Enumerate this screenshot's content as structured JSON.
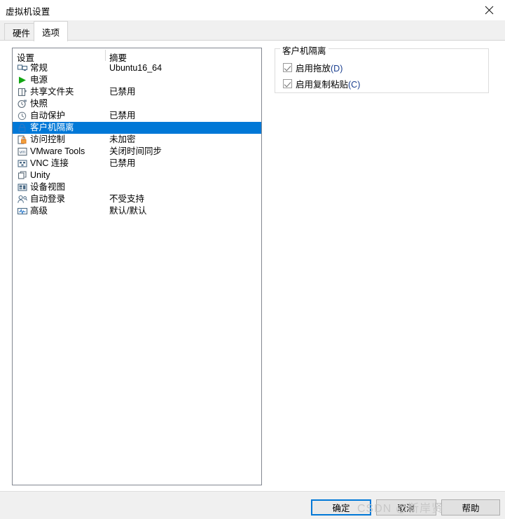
{
  "window": {
    "title": "虚拟机设置",
    "close_icon": "close-icon"
  },
  "tabs": [
    {
      "id": "hardware",
      "label": "硬件",
      "active": false
    },
    {
      "id": "options",
      "label": "选项",
      "active": true
    }
  ],
  "settings_list": {
    "columns": {
      "setting": "设置",
      "summary": "摘要"
    },
    "rows": [
      {
        "icon": "monitor-icon",
        "label": "常规",
        "summary": "Ubuntu16_64",
        "selected": false
      },
      {
        "icon": "power-play-icon",
        "label": "电源",
        "summary": "",
        "selected": false
      },
      {
        "icon": "folder-icon",
        "label": "共享文件夹",
        "summary": "已禁用",
        "selected": false
      },
      {
        "icon": "snapshot-icon",
        "label": "快照",
        "summary": "",
        "selected": false
      },
      {
        "icon": "clock-icon",
        "label": "自动保护",
        "summary": "已禁用",
        "selected": false
      },
      {
        "icon": "lock-icon",
        "label": "客户机隔离",
        "summary": "",
        "selected": true
      },
      {
        "icon": "access-lock-icon",
        "label": "访问控制",
        "summary": "未加密",
        "selected": false
      },
      {
        "icon": "vm-tools-icon",
        "label": "VMware Tools",
        "summary": "关闭时间同步",
        "selected": false
      },
      {
        "icon": "vnc-icon",
        "label": "VNC 连接",
        "summary": "已禁用",
        "selected": false
      },
      {
        "icon": "unity-icon",
        "label": "Unity",
        "summary": "",
        "selected": false
      },
      {
        "icon": "device-view-icon",
        "label": "设备视图",
        "summary": "",
        "selected": false
      },
      {
        "icon": "auto-login-icon",
        "label": "自动登录",
        "summary": "不受支持",
        "selected": false
      },
      {
        "icon": "advanced-icon",
        "label": "高级",
        "summary": "默认/默认",
        "selected": false
      }
    ]
  },
  "options_pane": {
    "group_title": "客户机隔离",
    "checkboxes": [
      {
        "id": "dragdrop",
        "label": "启用拖放",
        "mnemonic": "(D)",
        "checked": true
      },
      {
        "id": "copypaste",
        "label": "启用复制粘贴",
        "mnemonic": "(C)",
        "checked": true
      }
    ]
  },
  "footer": {
    "ok_label": "确定",
    "cancel_label": "取消",
    "help_label": "帮助"
  },
  "watermark": {
    "text": "CSDN @靳岸贤"
  },
  "colors": {
    "accent": "#0078d7",
    "selection": "#0078d7",
    "panel_border": "#828790",
    "footer_bg": "#f0f0f0"
  }
}
